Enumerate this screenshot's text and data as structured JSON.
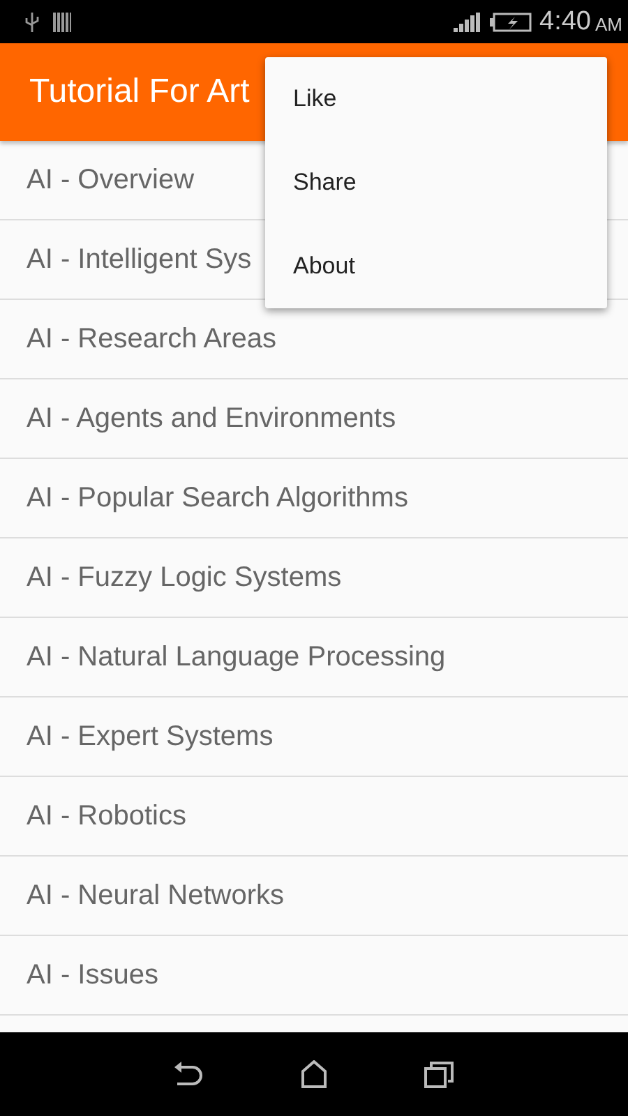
{
  "status_bar": {
    "time": "4:40",
    "ampm": "AM"
  },
  "app_bar": {
    "title": "Tutorial For Art"
  },
  "menu": {
    "items": [
      "Like",
      "Share",
      "About"
    ]
  },
  "list": {
    "items": [
      "AI - Overview",
      "AI - Intelligent Sys",
      "AI - Research Areas",
      "AI - Agents and Environments",
      "AI - Popular Search Algorithms",
      "AI - Fuzzy Logic Systems",
      "AI - Natural Language Processing",
      "AI - Expert Systems",
      "AI - Robotics",
      "AI - Neural Networks",
      "AI - Issues"
    ]
  }
}
